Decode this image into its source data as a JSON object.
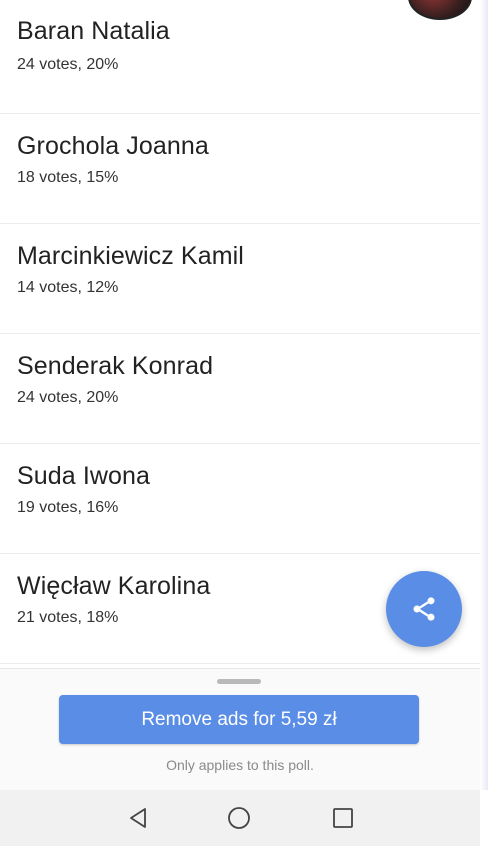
{
  "candidates": [
    {
      "name": "Baran Natalia",
      "votes": "24 votes, 20%"
    },
    {
      "name": "Grochola Joanna",
      "votes": "18 votes, 15%"
    },
    {
      "name": "Marcinkiewicz Kamil",
      "votes": "14 votes, 12%"
    },
    {
      "name": "Senderak Konrad",
      "votes": "24 votes, 20%"
    },
    {
      "name": "Suda Iwona",
      "votes": "19 votes, 16%"
    },
    {
      "name": "Więcław Karolina",
      "votes": "21 votes, 18%"
    }
  ],
  "fab": {
    "icon": "share-icon"
  },
  "bottom_sheet": {
    "button_label": "Remove ads for 5,59 zł",
    "note": "Only applies to this poll."
  },
  "navbar": {
    "back_icon": "back-triangle-icon",
    "home_icon": "home-circle-icon",
    "recents_icon": "recents-square-icon"
  },
  "colors": {
    "accent": "#5a8de6",
    "text": "#222222",
    "subtext": "#333333",
    "note": "#8a8a8a",
    "navbar_bg": "#f1f1f1"
  }
}
